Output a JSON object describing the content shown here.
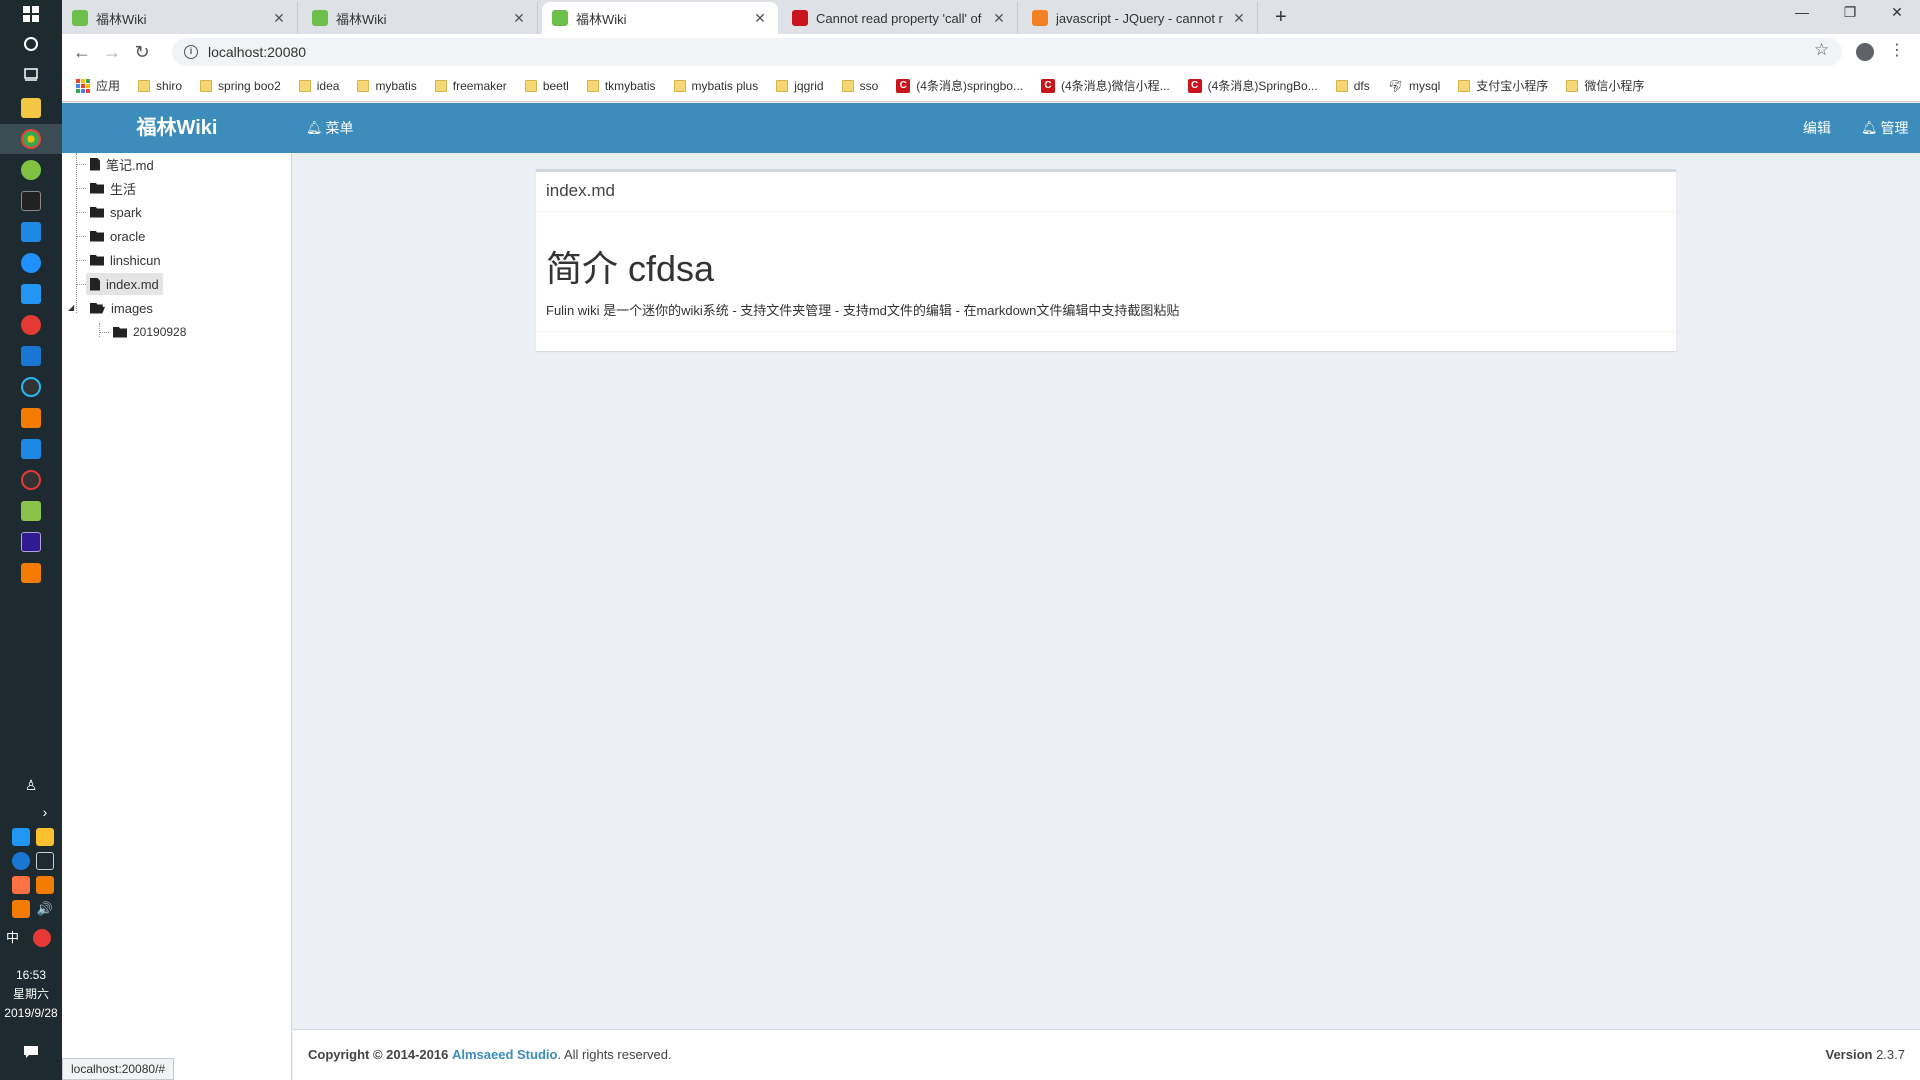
{
  "taskbar": {
    "clock_time": "16:53",
    "clock_day": "星期六",
    "clock_date": "2019/9/28",
    "ime": "中"
  },
  "browser": {
    "tabs": [
      {
        "title": "福林Wiki",
        "favicon": "leaf-icon",
        "color": "#6cc04a"
      },
      {
        "title": "福林Wiki",
        "favicon": "leaf-icon",
        "color": "#6cc04a"
      },
      {
        "title": "福林Wiki",
        "favicon": "leaf-icon",
        "color": "#6cc04a"
      },
      {
        "title": "Cannot read property 'call' of u",
        "favicon": "csdn-icon",
        "color": "#c9141b"
      },
      {
        "title": "javascript - JQuery - cannot re",
        "favicon": "stackoverflow-icon",
        "color": "#f48024"
      }
    ],
    "new_tab": "+",
    "url": "localhost:20080",
    "bookmarks": [
      {
        "label": "应用",
        "type": "apps"
      },
      {
        "label": "shiro",
        "type": "folder"
      },
      {
        "label": "spring boo2",
        "type": "folder"
      },
      {
        "label": "idea",
        "type": "folder"
      },
      {
        "label": "mybatis",
        "type": "folder"
      },
      {
        "label": "freemaker",
        "type": "folder"
      },
      {
        "label": "beetl",
        "type": "folder"
      },
      {
        "label": "tkmybatis",
        "type": "folder"
      },
      {
        "label": "mybatis plus",
        "type": "folder"
      },
      {
        "label": "jqgrid",
        "type": "folder"
      },
      {
        "label": "sso",
        "type": "folder"
      },
      {
        "label": "(4条消息)springbo...",
        "type": "csdn"
      },
      {
        "label": "(4条消息)微信小程...",
        "type": "csdn"
      },
      {
        "label": "(4条消息)SpringBo...",
        "type": "csdn"
      },
      {
        "label": "dfs",
        "type": "folder"
      },
      {
        "label": "mysql",
        "type": "mysql"
      },
      {
        "label": "支付宝小程序",
        "type": "folder"
      },
      {
        "label": "微信小程序",
        "type": "folder"
      }
    ],
    "status_url": "localhost:20080/#"
  },
  "app": {
    "logo": "福林Wiki",
    "menu_label": "菜单",
    "edit_label": "编辑",
    "manage_label": "管理",
    "header_color": "#3c8dbc",
    "tree": [
      {
        "label": "笔记.md",
        "type": "file"
      },
      {
        "label": "生活",
        "type": "folder"
      },
      {
        "label": "spark",
        "type": "folder"
      },
      {
        "label": "oracle",
        "type": "folder"
      },
      {
        "label": "linshicun",
        "type": "folder"
      },
      {
        "label": "index.md",
        "type": "file",
        "selected": true
      },
      {
        "label": "images",
        "type": "folder-open"
      },
      {
        "label": "20190928",
        "type": "folder"
      }
    ],
    "doc": {
      "filename": "index.md",
      "heading": "简介 cfdsa",
      "paragraph": "Fulin wiki 是一个迷你的wiki系统 - 支持文件夹管理 - 支持md文件的编辑 - 在markdown文件编辑中支持截图粘贴"
    },
    "footer": {
      "copyright_prefix": "Copyright © 2014-2016",
      "studio": "Almsaeed Studio",
      "rights": ". All rights reserved.",
      "version_label": "Version",
      "version": "2.3.7"
    }
  }
}
